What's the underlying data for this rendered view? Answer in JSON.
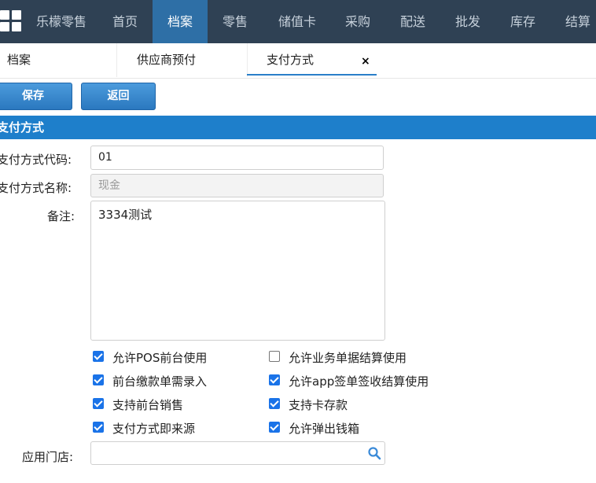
{
  "nav": {
    "brand": "乐檬零售",
    "items": [
      "首页",
      "档案",
      "零售",
      "储值卡",
      "采购",
      "配送",
      "批发",
      "库存",
      "结算"
    ],
    "active": "档案"
  },
  "tabs": [
    {
      "label": "档案"
    },
    {
      "label": "供应商预付"
    },
    {
      "label": "支付方式",
      "active": true,
      "close": "×"
    }
  ],
  "toolbar": {
    "save_label": "保存",
    "back_label": "返回"
  },
  "section": {
    "title": "支付方式"
  },
  "form": {
    "code_label": "支付方式代码:",
    "code_value": "01",
    "name_label": "支付方式名称:",
    "name_placeholder": "现金",
    "remark_label": "备注:",
    "remark_value": "3334测试",
    "store_label": "应用门店:",
    "store_value": ""
  },
  "checkboxes": [
    {
      "label": "允许POS前台使用",
      "checked": true
    },
    {
      "label": "允许业务单据结算使用",
      "checked": false
    },
    {
      "label": "前台缴款单需录入",
      "checked": true
    },
    {
      "label": "允许app签单签收结算使用",
      "checked": true
    },
    {
      "label": "支持前台销售",
      "checked": true
    },
    {
      "label": "支持卡存款",
      "checked": true
    },
    {
      "label": "支付方式即来源",
      "checked": true
    },
    {
      "label": "允许弹出钱箱",
      "checked": true
    }
  ],
  "colors": {
    "nav_bg": "#2f4154",
    "nav_active": "#2e6fa6",
    "accent": "#1e7fcb"
  }
}
